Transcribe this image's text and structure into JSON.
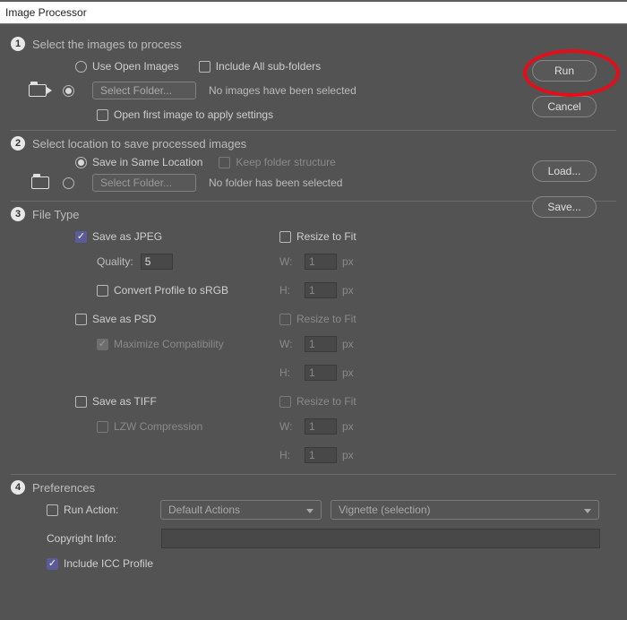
{
  "window": {
    "title": "Image Processor"
  },
  "buttons": {
    "run": "Run",
    "cancel": "Cancel",
    "load": "Load...",
    "save": "Save..."
  },
  "section1": {
    "title": "Select the images to process",
    "use_open_images": "Use Open Images",
    "include_subfolders": "Include All sub-folders",
    "select_folder": "Select Folder...",
    "status": "No images have been selected",
    "open_first": "Open first image to apply settings"
  },
  "section2": {
    "title": "Select location to save processed images",
    "save_same": "Save in Same Location",
    "keep_folder": "Keep folder structure",
    "select_folder": "Select Folder...",
    "status": "No folder has been selected"
  },
  "section3": {
    "title": "File Type",
    "jpeg": {
      "label": "Save as JPEG",
      "quality_label": "Quality:",
      "quality_value": "5",
      "convert_srgb": "Convert Profile to sRGB",
      "resize": "Resize to Fit",
      "w": "1",
      "h": "1"
    },
    "psd": {
      "label": "Save as PSD",
      "max_compat": "Maximize Compatibility",
      "resize": "Resize to Fit",
      "w": "1",
      "h": "1"
    },
    "tiff": {
      "label": "Save as TIFF",
      "lzw": "LZW Compression",
      "resize": "Resize to Fit",
      "w": "1",
      "h": "1"
    },
    "w_label": "W:",
    "h_label": "H:",
    "px": "px"
  },
  "section4": {
    "title": "Preferences",
    "run_action": "Run Action:",
    "action_set": "Default Actions",
    "action_name": "Vignette (selection)",
    "copyright": "Copyright Info:",
    "include_icc": "Include ICC Profile"
  },
  "step_nums": {
    "s1": "1",
    "s2": "2",
    "s3": "3",
    "s4": "4"
  }
}
